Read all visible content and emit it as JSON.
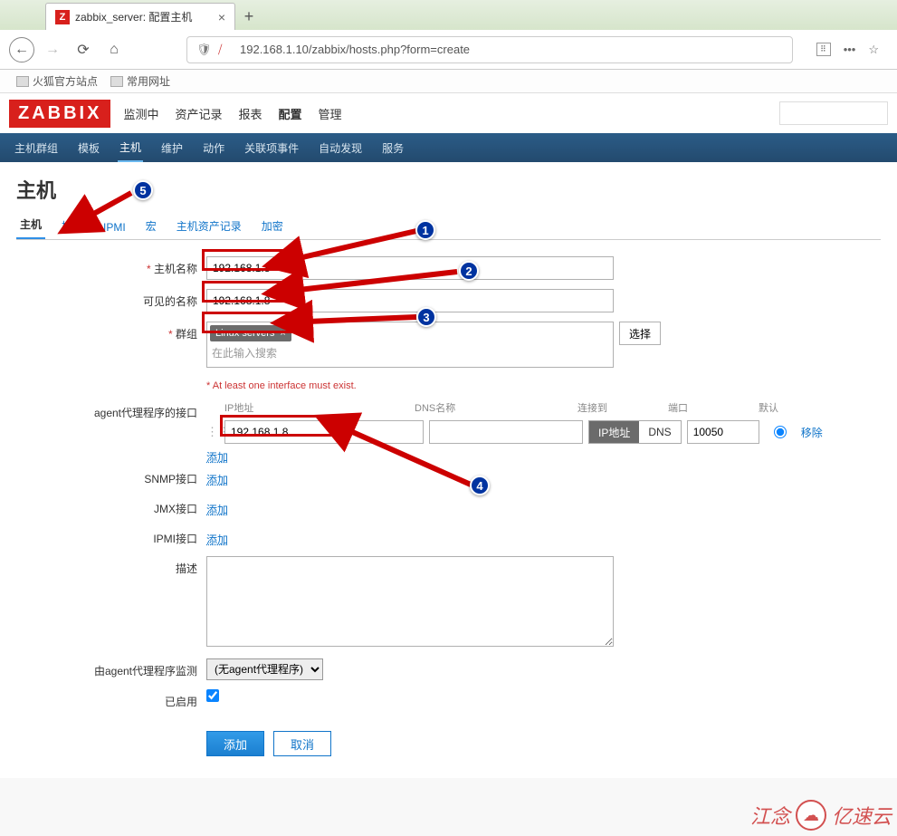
{
  "browser": {
    "tab": {
      "favicon_letter": "Z",
      "title": "zabbix_server: 配置主机"
    },
    "url": "192.168.1.10/zabbix/hosts.php?form=create",
    "bookmarks": [
      "火狐官方站点",
      "常用网址"
    ]
  },
  "zabbix": {
    "logo": "ZABBIX",
    "nav1": [
      "监测中",
      "资产记录",
      "报表",
      "配置",
      "管理"
    ],
    "nav1_active": "配置",
    "subnav": [
      "主机群组",
      "模板",
      "主机",
      "维护",
      "动作",
      "关联项事件",
      "自动发现",
      "服务"
    ],
    "subnav_active": "主机"
  },
  "page": {
    "title": "主机",
    "tabs": [
      "主机",
      "模板",
      "IPMI",
      "宏",
      "主机资产记录",
      "加密"
    ],
    "tab_active": "主机"
  },
  "form": {
    "host_name": {
      "label": "主机名称",
      "value": "192.168.1.8",
      "required": true
    },
    "visible_name": {
      "label": "可见的名称",
      "value": "192.168.1.8"
    },
    "groups": {
      "label": "群组",
      "required": true,
      "tag": "Linux servers",
      "placeholder": "在此输入搜索",
      "select_btn": "选择"
    },
    "warning": "At least one interface must exist.",
    "agent_if": {
      "label": "agent代理程序的接口",
      "cols": {
        "ip": "IP地址",
        "dns": "DNS名称",
        "connect": "连接到",
        "port": "端口",
        "default": "默认"
      },
      "ip": "192.168.1.8",
      "dns": "",
      "connect_opts": [
        "IP地址",
        "DNS"
      ],
      "connect_sel": "IP地址",
      "port": "10050",
      "default": true,
      "remove": "移除",
      "add": "添加"
    },
    "snmp_if": {
      "label": "SNMP接口",
      "add": "添加"
    },
    "jmx_if": {
      "label": "JMX接口",
      "add": "添加"
    },
    "ipmi_if": {
      "label": "IPMI接口",
      "add": "添加"
    },
    "description": {
      "label": "描述",
      "value": ""
    },
    "proxy": {
      "label": "由agent代理程序监测",
      "value": "(无agent代理程序)"
    },
    "enabled": {
      "label": "已启用",
      "value": true
    },
    "actions": {
      "add": "添加",
      "cancel": "取消"
    }
  },
  "annotations": {
    "callouts": {
      "1": "1",
      "2": "2",
      "3": "3",
      "4": "4",
      "5": "5"
    }
  },
  "watermark": {
    "text1": "江念",
    "text2": "亿速云"
  }
}
